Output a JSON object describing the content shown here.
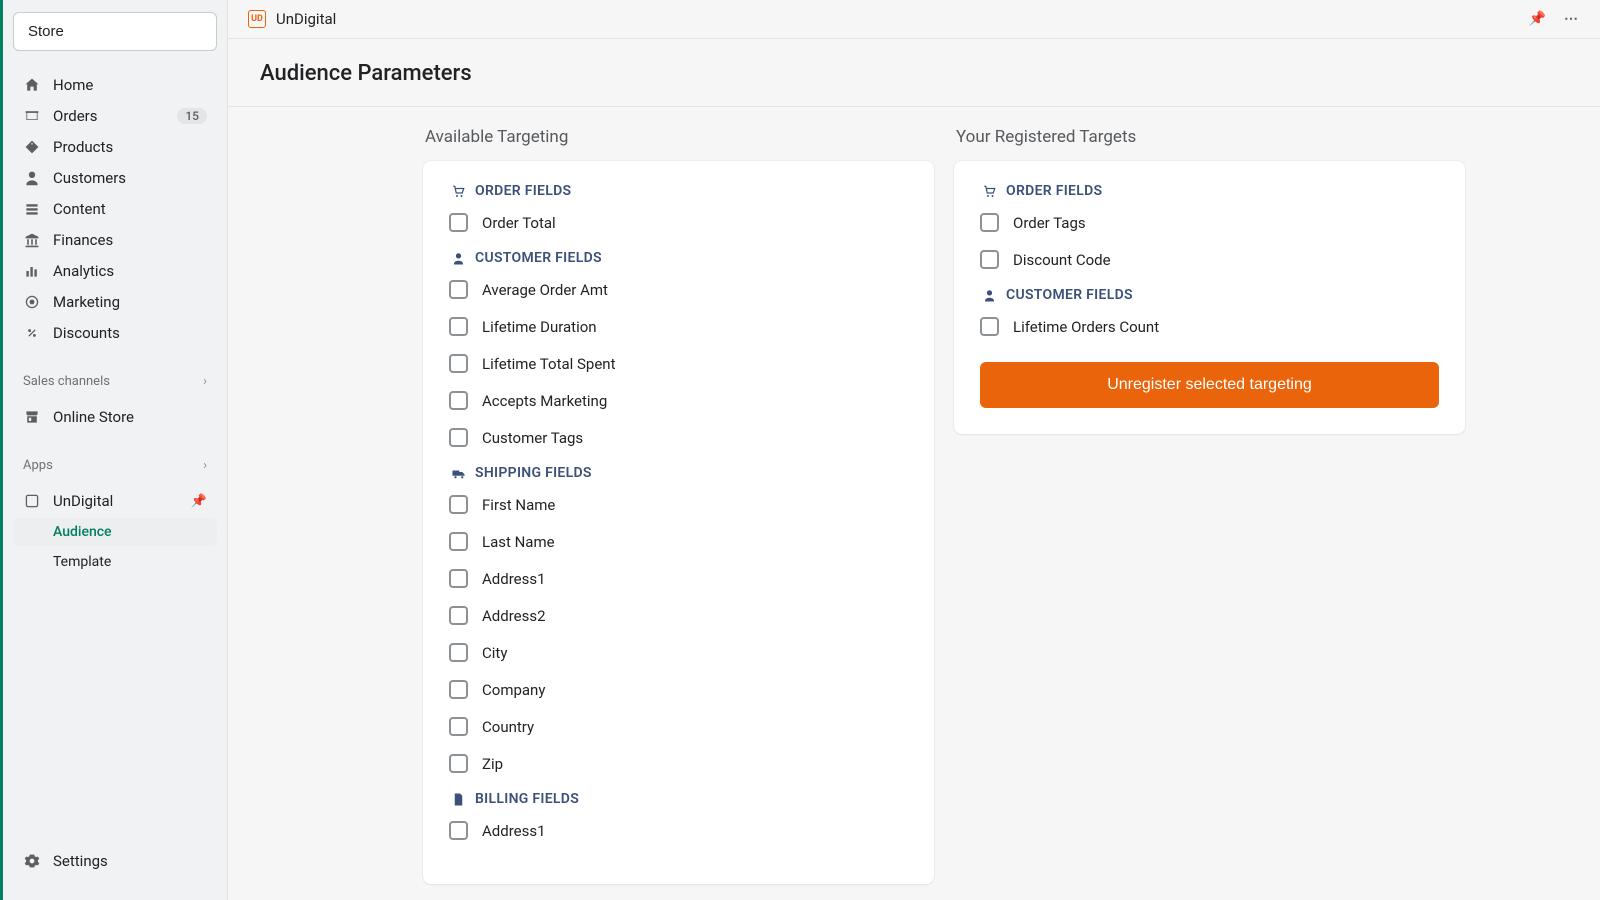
{
  "sidebar": {
    "store_button": "Store",
    "nav": [
      {
        "label": "Home",
        "icon": "home"
      },
      {
        "label": "Orders",
        "icon": "orders",
        "badge": "15"
      },
      {
        "label": "Products",
        "icon": "tag"
      },
      {
        "label": "Customers",
        "icon": "person"
      },
      {
        "label": "Content",
        "icon": "content"
      },
      {
        "label": "Finances",
        "icon": "bank"
      },
      {
        "label": "Analytics",
        "icon": "analytics"
      },
      {
        "label": "Marketing",
        "icon": "target"
      },
      {
        "label": "Discounts",
        "icon": "discount"
      }
    ],
    "sales_channels_label": "Sales channels",
    "online_store_label": "Online Store",
    "apps_label": "Apps",
    "app_name": "UnDigital",
    "sub_items": [
      {
        "label": "Audience",
        "active": true
      },
      {
        "label": "Template",
        "active": false
      }
    ],
    "settings_label": "Settings"
  },
  "header": {
    "app_title": "UnDigital",
    "page_title": "Audience Parameters"
  },
  "columns": {
    "available": {
      "title": "Available Targeting",
      "groups": [
        {
          "header": "ORDER FIELDS",
          "icon": "cart",
          "items": [
            "Order Total"
          ]
        },
        {
          "header": "CUSTOMER FIELDS",
          "icon": "person",
          "items": [
            "Average Order Amt",
            "Lifetime Duration",
            "Lifetime Total Spent",
            "Accepts Marketing",
            "Customer Tags"
          ]
        },
        {
          "header": "SHIPPING FIELDS",
          "icon": "truck",
          "items": [
            "First Name",
            "Last Name",
            "Address1",
            "Address2",
            "City",
            "Company",
            "Country",
            "Zip"
          ]
        },
        {
          "header": "BILLING FIELDS",
          "icon": "file",
          "items": [
            "Address1"
          ]
        }
      ]
    },
    "registered": {
      "title": "Your Registered Targets",
      "groups": [
        {
          "header": "ORDER FIELDS",
          "icon": "cart",
          "items": [
            "Order Tags",
            "Discount Code"
          ]
        },
        {
          "header": "CUSTOMER FIELDS",
          "icon": "person",
          "items": [
            "Lifetime Orders Count"
          ]
        }
      ],
      "action_button": "Unregister selected targeting"
    }
  }
}
